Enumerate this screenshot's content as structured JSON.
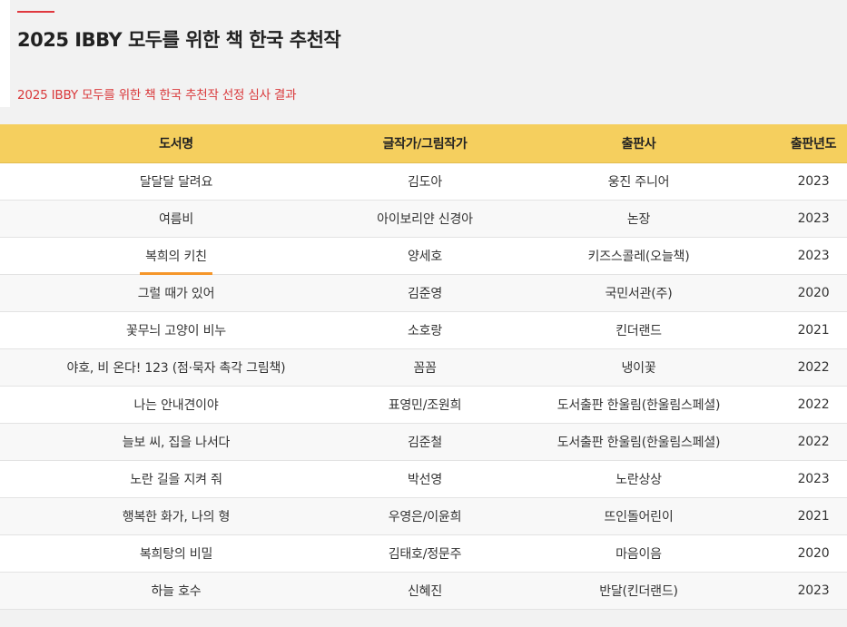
{
  "page": {
    "title": "2025 IBBY 모두를 위한 책 한국 추천작",
    "subtitle": "2025 IBBY 모두를 위한 책 한국 추천작 선정 심사 결과"
  },
  "colors": {
    "accent": "#e0383e",
    "header_bg": "#f5cf5e",
    "selection": "#f5962a"
  },
  "table": {
    "headers": [
      "도서명",
      "글작가/그림작가",
      "출판사",
      "출판년도"
    ],
    "selected_row": 2,
    "rows": [
      {
        "title": "달달달 달려요",
        "author": "김도아",
        "publisher": "웅진 주니어",
        "year": "2023"
      },
      {
        "title": "여름비",
        "author": "아이보리얀 신경아",
        "publisher": "논장",
        "year": "2023"
      },
      {
        "title": "복희의 키친",
        "author": "양세호",
        "publisher": "키즈스콜레(오늘책)",
        "year": "2023"
      },
      {
        "title": "그럴 때가 있어",
        "author": "김준영",
        "publisher": "국민서관(주)",
        "year": "2020"
      },
      {
        "title": "꽃무늬 고양이 비누",
        "author": "소호랑",
        "publisher": "킨더랜드",
        "year": "2021"
      },
      {
        "title": "야호, 비 온다! 123 (점·묵자 촉각 그림책)",
        "author": "꼼꼼",
        "publisher": "냉이꽃",
        "year": "2022"
      },
      {
        "title": "나는 안내견이야",
        "author": "표영민/조원희",
        "publisher": "도서출판 한울림(한울림스페셜)",
        "year": "2022"
      },
      {
        "title": "늘보 씨, 집을 나서다",
        "author": "김준철",
        "publisher": "도서출판 한울림(한울림스페셜)",
        "year": "2022"
      },
      {
        "title": "노란 길을 지켜 줘",
        "author": "박선영",
        "publisher": "노란상상",
        "year": "2023"
      },
      {
        "title": "행복한 화가, 나의 형",
        "author": "우영은/이윤희",
        "publisher": "뜨인돌어린이",
        "year": "2021"
      },
      {
        "title": "복희탕의 비밀",
        "author": "김태호/정문주",
        "publisher": "마음이음",
        "year": "2020"
      },
      {
        "title": "하늘 호수",
        "author": "신혜진",
        "publisher": "반달(킨더랜드)",
        "year": "2023"
      }
    ]
  }
}
